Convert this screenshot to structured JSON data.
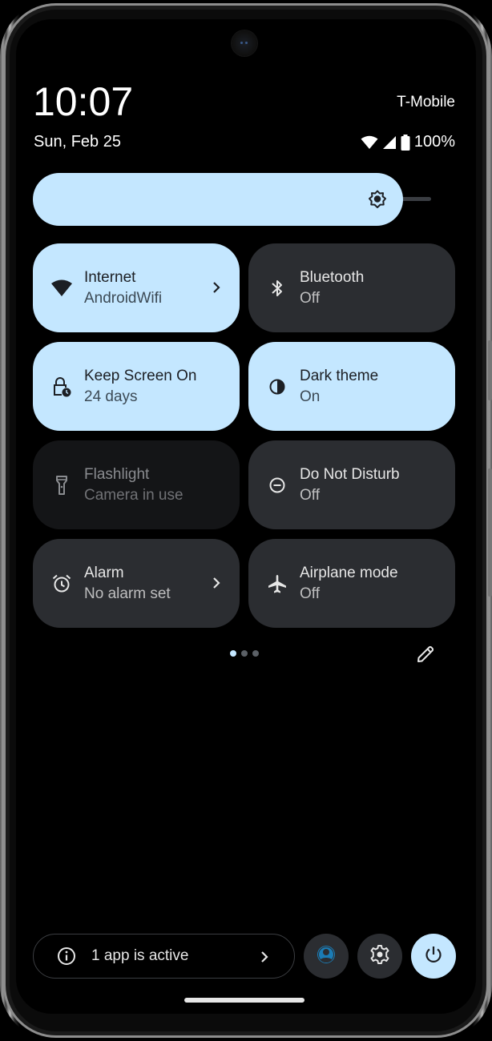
{
  "status_bar": {
    "time": "10:07",
    "date": "Sun, Feb 25",
    "carrier": "T-Mobile",
    "battery_percent": "100%",
    "icons": [
      "wifi-icon",
      "cellular-signal-icon",
      "battery-icon"
    ]
  },
  "brightness": {
    "icon": "brightness-icon",
    "level_percent": 93
  },
  "tiles": [
    {
      "label": "Internet",
      "sub": "AndroidWifi",
      "state": "on",
      "icon": "wifi-icon",
      "has_chevron": true
    },
    {
      "label": "Bluetooth",
      "sub": "Off",
      "state": "off",
      "icon": "bluetooth-icon",
      "has_chevron": false
    },
    {
      "label": "Keep Screen On",
      "sub": "24 days",
      "state": "on",
      "icon": "lock-clock-icon",
      "has_chevron": false
    },
    {
      "label": "Dark theme",
      "sub": "On",
      "state": "on",
      "icon": "contrast-icon",
      "has_chevron": false
    },
    {
      "label": "Flashlight",
      "sub": "Camera in use",
      "state": "disabled",
      "icon": "flashlight-icon",
      "has_chevron": false
    },
    {
      "label": "Do Not Disturb",
      "sub": "Off",
      "state": "off",
      "icon": "do-not-disturb-icon",
      "has_chevron": false
    },
    {
      "label": "Alarm",
      "sub": "No alarm set",
      "state": "off",
      "icon": "alarm-icon",
      "has_chevron": true
    },
    {
      "label": "Airplane mode",
      "sub": "Off",
      "state": "off",
      "icon": "airplane-icon",
      "has_chevron": false
    }
  ],
  "pager": {
    "pages": 3,
    "current": 1
  },
  "edit": {
    "icon": "pencil-icon"
  },
  "footer": {
    "active_apps_label": "1 app is active",
    "buttons": [
      "user-icon",
      "settings-icon",
      "power-icon"
    ]
  },
  "colors": {
    "tile_on": "#c4e7ff",
    "tile_off": "#2b2d31",
    "tile_disabled": "#141517",
    "user_accent": "#1b7cb5"
  }
}
